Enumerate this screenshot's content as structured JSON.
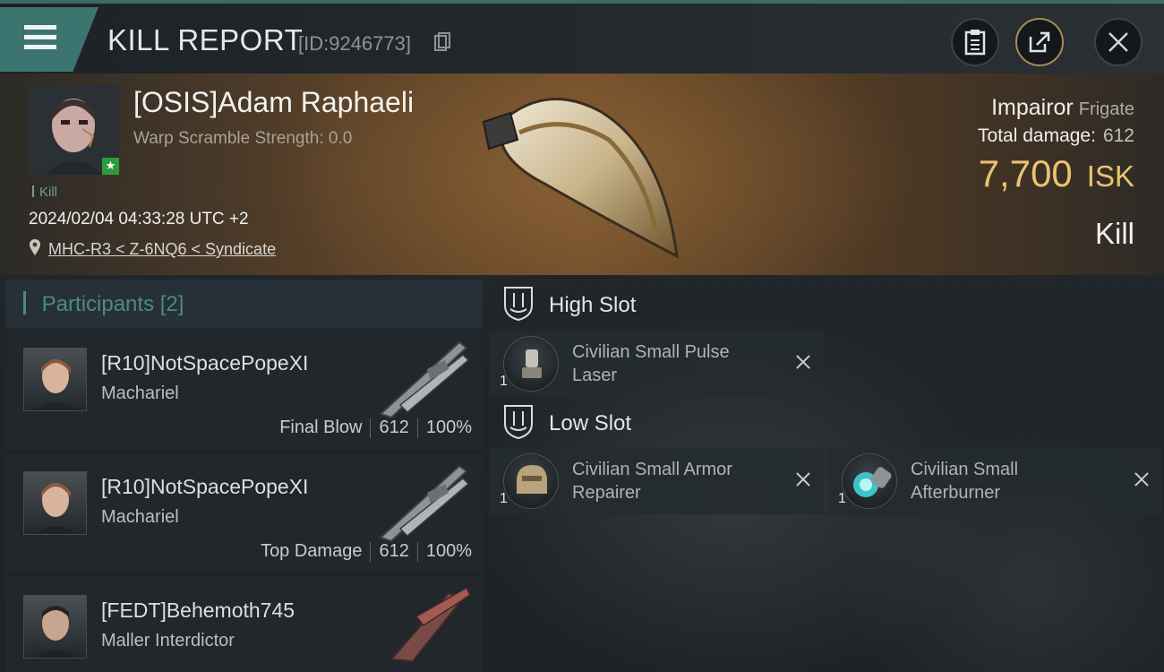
{
  "header": {
    "title": "KILL REPORT",
    "report_id": "[ID:9246773]"
  },
  "victim": {
    "name": "[OSIS]Adam Raphaeli",
    "warp_scramble": "Warp Scramble Strength: 0.0",
    "kill_tag": "Kill",
    "timestamp": "2024/02/04 04:33:28 UTC +2",
    "location": "MHC-R3 < Z-6NQ6 < Syndicate",
    "ship_name": "Impairor",
    "ship_class": "Frigate",
    "total_damage_label": "Total damage:",
    "total_damage_value": "612",
    "isk_value": "7,700",
    "isk_unit": "ISK",
    "result_label": "Kill"
  },
  "participants": {
    "title": "Participants",
    "count": "[2]",
    "items": [
      {
        "name": "[R10]NotSpacePopeXI",
        "ship": "Machariel",
        "role": "Final Blow",
        "damage": "612",
        "percent": "100%"
      },
      {
        "name": "[R10]NotSpacePopeXI",
        "ship": "Machariel",
        "role": "Top Damage",
        "damage": "612",
        "percent": "100%"
      },
      {
        "name": "[FEDT]Behemoth745",
        "ship": "Maller Interdictor",
        "role": "",
        "damage": "",
        "percent": ""
      }
    ]
  },
  "slots": {
    "high": {
      "title": "High Slot",
      "modules": [
        {
          "name": "Civilian Small Pulse Laser",
          "qty": "1"
        }
      ]
    },
    "low": {
      "title": "Low Slot",
      "modules": [
        {
          "name": "Civilian Small Armor Repairer",
          "qty": "1"
        },
        {
          "name": "Civilian Small Afterburner",
          "qty": "1"
        }
      ]
    }
  },
  "colors": {
    "accent_teal": "#3c7470",
    "isk_gold": "#e9c46f",
    "kill_green": "#6fa08e"
  }
}
